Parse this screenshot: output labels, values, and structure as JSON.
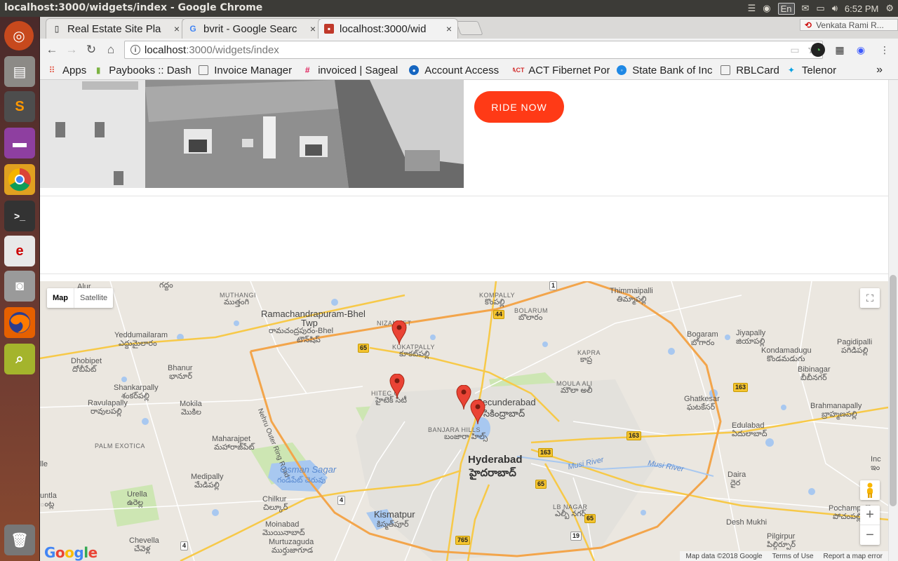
{
  "window": {
    "title": "localhost:3000/widgets/index - Google Chrome"
  },
  "tray": {
    "lang": "En",
    "time": "6:52 PM"
  },
  "tabs": [
    {
      "label": "Real Estate Site Pla",
      "close": "×"
    },
    {
      "label": "bvrit - Google Searc",
      "close": "×"
    },
    {
      "label": "localhost:3000/wid",
      "close": "×"
    }
  ],
  "profile": {
    "name": "Venkata Rami R..."
  },
  "address": {
    "host": "localhost",
    "path": ":3000/widgets/index"
  },
  "bookmarks": [
    {
      "label": "Apps",
      "icon": "apps-grid-icon",
      "color": "#e0402c"
    },
    {
      "label": "Paybooks :: Dash",
      "icon": "paybooks-icon",
      "color": "#7cb342"
    },
    {
      "label": "Invoice Manager",
      "icon": "page-icon",
      "color": "#ffffff"
    },
    {
      "label": "invoiced | Sageal",
      "icon": "slack-icon",
      "color": "#e01e5a"
    },
    {
      "label": "Account Access",
      "icon": "account-icon",
      "color": "#1565c0"
    },
    {
      "label": "ACT Fibernet Por",
      "icon": "act-icon",
      "color": "#d32f2f"
    },
    {
      "label": "State Bank of Inc",
      "icon": "sbi-icon",
      "color": "#1e88e5"
    },
    {
      "label": "RBLCard",
      "icon": "page-icon",
      "color": "#ffffff"
    },
    {
      "label": "Telenor",
      "icon": "telenor-icon",
      "color": "#00a0e3"
    }
  ],
  "bookmarks_overflow": "»",
  "page": {
    "ride_button": "RIDE NOW",
    "accent": "#ff3a16"
  },
  "map": {
    "type_map": "Map",
    "type_satellite": "Satellite",
    "logo": "Google",
    "attribution": {
      "data": "Map data ©2018 Google",
      "terms": "Terms of Use",
      "report": "Report a map error"
    },
    "zoom_in": "+",
    "zoom_out": "−",
    "labels": {
      "alur": "Alur",
      "muthangi": "MUTHANGI",
      "muthangi_te": "ముత్తంగి",
      "ramachandrapuram": "Ramachandrapuram-Bhel",
      "twp": "Twp",
      "ramachandrapuram_te": "రామచంద్రపురం-Bhel",
      "twp_te": "టౌన్‌షిప్",
      "nizampet": "NIZAMPET",
      "kompally": "KOMPALLY",
      "kompally_te": "కొంపల్లి",
      "bolarum": "BOLARUM",
      "bolarum_te": "బొలారం",
      "thimmaipalli": "Thimmaipalli",
      "thimmaipalli_te": "తిమ్మాపల్లి",
      "yeddumailaram": "Yeddumailaram",
      "yeddumailaram_te": "ఎద్దుమైలారం",
      "kukatpally": "KUKATPALLY",
      "kukatpally_te": "కూకట్‌పల్లి",
      "bogaram": "Bogaram",
      "bogaram_te": "బోగారం",
      "jiyapally": "Jiyapally",
      "jiyapally_te": "జియాపల్లి",
      "kondamadugu": "Kondamadugu",
      "kondamadugu_te": "కొండమడుగు",
      "pagidipalli": "Pagidipalli",
      "pagidipalli_te": "పగిడిపల్లి",
      "dhobipet": "Dhobipet",
      "dhobipet_te": "దోబీపేట్",
      "bhanur": "Bhanur",
      "bhanur_te": "భానూర్",
      "kapra": "KAPRA",
      "kapra_te": "కాప్ర",
      "bibinagar": "Bibinagar",
      "bibinagar_te": "బీబీనగర్",
      "shankarpally": "Shankarpally",
      "shankarpally_te": "శంకర్‌పల్లి",
      "hitec": "HITEC C",
      "hitec_te": "హైటెక్ సిటీ",
      "moula_ali": "MOULA ALI",
      "moula_ali_te": "మౌలా అలీ",
      "secunderabad": "Secunderabad",
      "secunderabad_te": "సికింద్రాబాద్",
      "ghatkesar": "Ghatkesar",
      "ghatkesar_te": "ఘటకేసర్",
      "ravulapally": "Ravulapally",
      "ravulapally_te": "రావులపల్లి",
      "mokila": "Mokila",
      "mokila_te": "మొకిల",
      "banjara": "BANJARA HILLS",
      "banjara_te": "బంజారా హిల్స్",
      "brahmanapally": "Brahmanapally",
      "brahmanapally_te": "బ్రాహ్మణపల్లి",
      "palm_exotica": "PALM EXOTICA",
      "maharajpet": "Maharajpet",
      "maharajpet_te": "మహారాజ్‌పేట్",
      "orr": "Nehru Outer Ring Road",
      "edulabad": "Edulabad",
      "edulabad_te": "ఏదులాబాద్",
      "musi_river": "Musi River",
      "musi_river2": "Musi River",
      "hyderabad": "Hyderabad",
      "hyderabad_te": "హైదరాబాద్",
      "osman_sagar": "Osman Sagar",
      "osman_sagar_te": "గండిపేట్ చెరువు",
      "medipally": "Medipally",
      "medipally_te": "మేడిపల్లి",
      "daira": "Daira",
      "daira_te": "దైర",
      "urella": "Urella",
      "urella_te": "ఉరెల్ల",
      "chilkur": "Chilkur",
      "chilkur_te": "చిల్కూర్",
      "lb_nagar": "LB NAGAR",
      "lb_nagar_te": "ఎల్బీ నగర్",
      "kismatpur": "Kismatpur",
      "kismatpur_te": "కిస్మత్‌పూర్",
      "desh_mukhi": "Desh Mukhi",
      "pochampalli": "Pochampalli",
      "pochampalli_te": "పోచంపల్లి",
      "moinabad": "Moinabad",
      "moinabad_te": "మొయినాబాద్",
      "murtuzaguda": "Murtuzaguda",
      "murtuzaguda_te": "ముర్తుజాగూడ",
      "chevella": "Chevella",
      "chevella_te": "చేవెళ్ల",
      "pilgirpur": "Pilgirpur",
      "pilgirpur_te": "పిల్గిర్పూర్",
      "lle": "lle",
      "untla": "untla",
      "untla_te": "ంట్ల",
      "ino": "Inc",
      "ino_te": "ఇం",
      "pochampalli_prefix": "Pochampalli",
      "adkam": "గద్దం"
    },
    "shields": {
      "h44": "44",
      "h65a": "65",
      "h163a": "163",
      "h163b": "163",
      "h163c": "163",
      "h65b": "65",
      "h65c": "65",
      "h765": "765",
      "h4": "4",
      "h4b": "4",
      "h19": "19",
      "h1": "1"
    }
  }
}
